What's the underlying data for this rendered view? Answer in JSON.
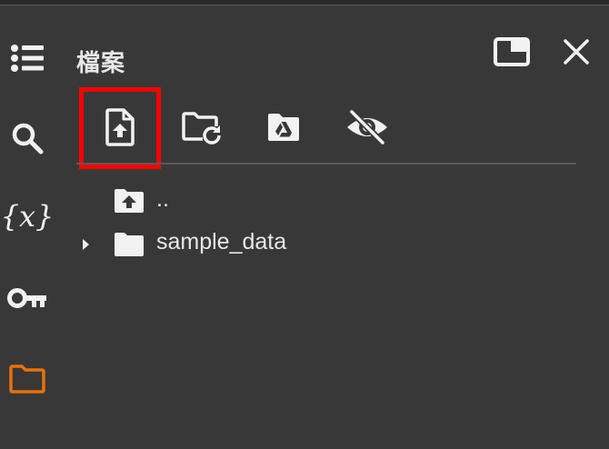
{
  "sidebar": {
    "icons": [
      {
        "name": "table-of-contents-icon"
      },
      {
        "name": "search-icon"
      },
      {
        "name": "variables-icon",
        "glyph": "{x}"
      },
      {
        "name": "secrets-key-icon"
      },
      {
        "name": "files-folder-icon",
        "color": "#e8710a"
      }
    ]
  },
  "panel": {
    "title": "檔案",
    "maximize_icon": "maximize-icon",
    "close_icon": "close-icon"
  },
  "toolbar": {
    "buttons": [
      {
        "name": "upload-file-button",
        "icon": "upload-file-icon",
        "highlighted": true
      },
      {
        "name": "refresh-button",
        "icon": "folder-refresh-icon"
      },
      {
        "name": "mount-drive-button",
        "icon": "google-drive-icon"
      },
      {
        "name": "toggle-hidden-files-button",
        "icon": "eye-off-icon"
      }
    ],
    "highlight_color": "#ff0000"
  },
  "file_tree": {
    "parent": {
      "label": ".."
    },
    "items": [
      {
        "label": "sample_data",
        "type": "folder",
        "expanded": false
      }
    ]
  },
  "colors": {
    "background": "#383838",
    "text": "#e8e8e8",
    "accent": "#e8710a"
  }
}
